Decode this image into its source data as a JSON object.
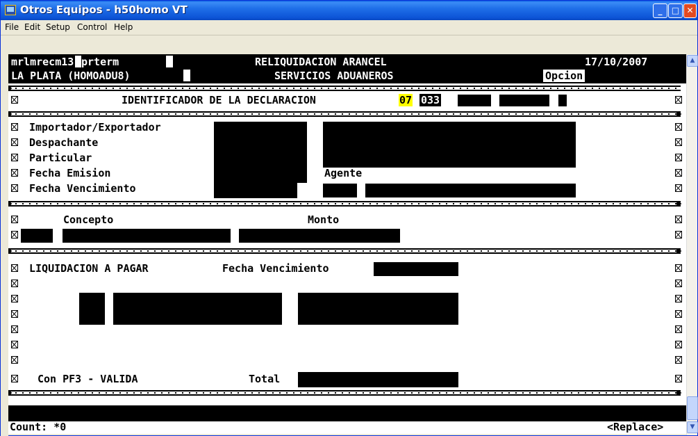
{
  "window": {
    "title": "Otros Equipos - h50homo VT",
    "buttons": {
      "minimize": "_",
      "maximize": "□",
      "close": "✕"
    }
  },
  "menu": [
    "File",
    "Edit",
    "Setup",
    "Control",
    "Help"
  ],
  "terminal": {
    "header": {
      "program": "mrlmrecm13",
      "terminal": "prterm",
      "title": "RELIQUIDACION ARANCEL",
      "date": "17/10/2007",
      "location": "LA PLATA (HOMOADU8)",
      "subtitle": "SERVICIOS ADUANEROS",
      "option_label": "Opcion"
    },
    "identifier": {
      "label": "IDENTIFICADOR DE LA DECLARACION",
      "year": "07",
      "code": "033"
    },
    "fields": {
      "importador": "Importador/Exportador",
      "despachante": "Despachante",
      "particular": "Particular",
      "fecha_emision": "Fecha Emision",
      "agente": "Agente",
      "fecha_vencimiento": "Fecha Vencimiento"
    },
    "concepts": {
      "concepto": "Concepto",
      "monto": "Monto"
    },
    "liquidacion": {
      "label": "LIQUIDACION A PAGAR",
      "fecha_vencimiento": "Fecha Vencimiento",
      "pf3": "Con PF3 - VALIDA",
      "total": "Total"
    },
    "status": {
      "count": "Count: *0",
      "mode": "<Replace>"
    }
  }
}
